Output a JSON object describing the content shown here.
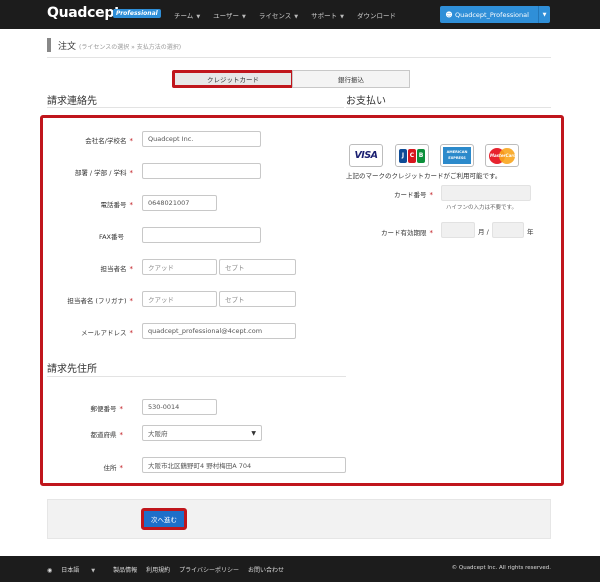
{
  "navbar": {
    "brand": "Quadcept",
    "badge": "Professional",
    "menu": [
      {
        "label": "チーム",
        "has_caret": true
      },
      {
        "label": "ユーザー",
        "has_caret": true
      },
      {
        "label": "ライセンス",
        "has_caret": true
      },
      {
        "label": "サポート",
        "has_caret": true
      },
      {
        "label": "ダウンロード",
        "has_caret": false
      }
    ],
    "user_button": "Quadcept_Professional",
    "user_icon": "user-icon"
  },
  "header": {
    "title": "注文",
    "breadcrumb": "(ライセンスの選択 » 支払方法の選択)"
  },
  "tabs": [
    {
      "label": "クレジットカード",
      "active": true
    },
    {
      "label": "銀行振込",
      "active": false
    }
  ],
  "billing_contact": {
    "heading": "請求連絡先",
    "fields": [
      {
        "label": "会社名/学校名",
        "required": true,
        "value": "Quadcept Inc."
      },
      {
        "label": "部署 / 学部 / 学科",
        "required": true,
        "value": ""
      },
      {
        "label": "電話番号",
        "required": true,
        "value": "0648021007"
      },
      {
        "label": "FAX番号",
        "required": false,
        "value": ""
      },
      {
        "label": "担当者名",
        "required": true,
        "value": "",
        "placeholder_last": "クアッド",
        "placeholder_first": "セプト"
      },
      {
        "label": "担当者名 (フリガナ)",
        "required": true,
        "value": "",
        "placeholder_last": "クアッド",
        "placeholder_first": "セプト"
      },
      {
        "label": "メールアドレス",
        "required": true,
        "value": "quadcept_professional@4cept.com"
      }
    ]
  },
  "billing_address": {
    "heading": "請求先住所",
    "fields": [
      {
        "label": "郵便番号",
        "required": true,
        "value": "530-0014"
      },
      {
        "label": "都道府県",
        "required": true,
        "value": "大阪府"
      },
      {
        "label": "住所",
        "required": true,
        "value": "大阪市北区鶴野町4 野村梅田A 704"
      }
    ]
  },
  "payment": {
    "heading": "お支払い",
    "cards": [
      "VISA",
      "JCB",
      "AMERICAN EXPRESS",
      "MasterCard"
    ],
    "cards_note": "上記のマークのクレジットカードがご利用可能です。",
    "card_number_label": "カード番号",
    "card_number_hint": "ハイフンの入力は不要です。",
    "expiry_label": "カード有効期限",
    "month_unit": "月 /",
    "year_unit": "年"
  },
  "actions": {
    "next_label": "次へ進む"
  },
  "footer": {
    "links": [
      "日本語",
      "製品情報",
      "利用規約",
      "プライバシーポリシー",
      "お問い合わせ"
    ],
    "copyright": "© Quadcept Inc. All rights reserved."
  },
  "colors": {
    "navbar_bg": "#1c1c1c",
    "accent": "#2f8fd8",
    "highlight": "#c0161c",
    "button_bg": "#1e6fc9"
  }
}
